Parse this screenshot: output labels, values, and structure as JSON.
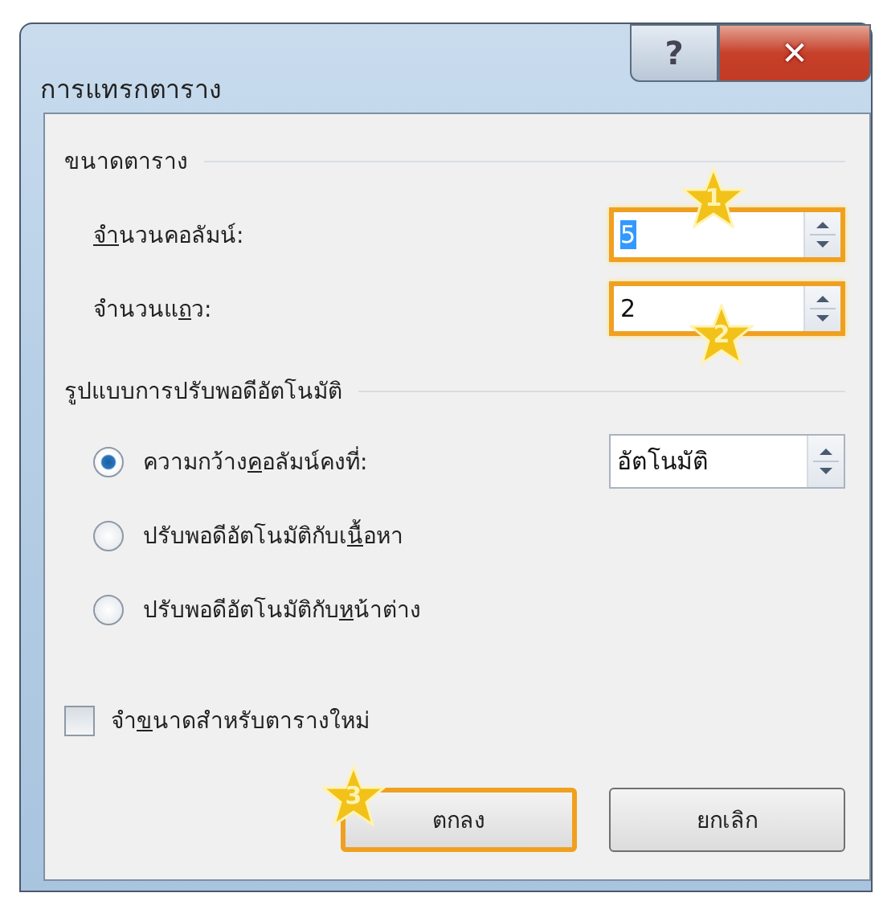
{
  "window": {
    "title": "การแทรกตาราง"
  },
  "title_buttons": [
    {
      "kind": "help",
      "label": "?"
    },
    {
      "kind": "close",
      "label": "✕"
    }
  ],
  "table_size": {
    "heading": "ขนาดตาราง",
    "fields": [
      {
        "label": {
          "key": "จ",
          "post": "ำนวนคอลัมน์:"
        },
        "value": "5",
        "value_highlighted": true,
        "callout": "1",
        "outlined": true
      },
      {
        "label": {
          "pre": "จำนวนแ",
          "key": "ถ",
          "post": "ว:"
        },
        "value": "2",
        "value_highlighted": false,
        "callout": "2",
        "outlined": true
      }
    ]
  },
  "autofit": {
    "heading": "รูปแบบการปรับพอดีอัตโนมัติ",
    "options": [
      {
        "label": {
          "pre": "ความกว้าง",
          "key": "ค",
          "post": "อลัมน์คงที่:"
        },
        "selected": true,
        "spinner": "อัตโนมัติ"
      },
      {
        "label": {
          "pre": "ปรับพอดีอัตโนมัติกับเ",
          "key": "นื้",
          "post": "อหา"
        },
        "selected": false
      },
      {
        "label": {
          "pre": "ปรับพอดีอัตโนมัติกับ",
          "key": "ห",
          "post": "น้าต่าง"
        },
        "selected": false
      }
    ]
  },
  "remember": {
    "label": {
      "pre": "จำ",
      "key": "ข",
      "post": "นาดสำหรับตารางใหม่"
    },
    "checked": false
  },
  "buttons": [
    {
      "label": "ตกลง",
      "callout": "3",
      "outlined": true
    },
    {
      "label": "ยกเลิก",
      "outlined": false
    }
  ]
}
